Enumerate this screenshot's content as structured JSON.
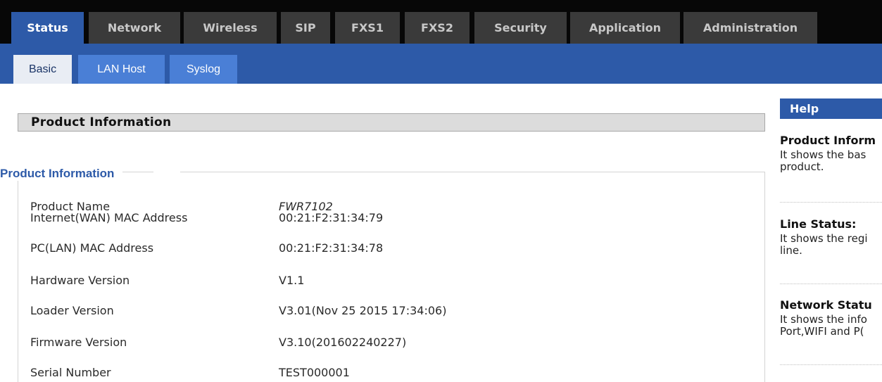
{
  "nav": {
    "tabs": [
      "Status",
      "Network",
      "Wireless",
      "SIP",
      "FXS1",
      "FXS2",
      "Security",
      "Application",
      "Administration"
    ],
    "active_tab": "Status"
  },
  "subnav": {
    "tabs": [
      "Basic",
      "LAN Host",
      "Syslog"
    ],
    "active_tab": "Basic"
  },
  "section": {
    "header": "Product Information",
    "legend": "Product Information",
    "rows": [
      {
        "label": "Product Name",
        "value": "FWR7102"
      },
      {
        "label": "Internet(WAN) MAC Address",
        "value": "00:21:F2:31:34:79"
      },
      {
        "label": "PC(LAN) MAC Address",
        "value": "00:21:F2:31:34:78"
      },
      {
        "label": "Hardware Version",
        "value": "V1.1"
      },
      {
        "label": "Loader Version",
        "value": "V3.01(Nov 25 2015 17:34:06)"
      },
      {
        "label": "Firmware Version",
        "value": "V3.10(201602240227)"
      },
      {
        "label": "Serial Number",
        "value": "TEST000001"
      }
    ]
  },
  "help": {
    "header": "Help",
    "items": [
      {
        "title": "Product Inform",
        "line1": "It shows the bas",
        "line2": "product."
      },
      {
        "title": "Line Status:",
        "line1": "It shows the regi",
        "line2": "line."
      },
      {
        "title": "Network Statu",
        "line1": "It shows the info",
        "line2": "Port,WIFI and P("
      }
    ]
  },
  "colors": {
    "nav_bg": "#070707",
    "tab_bg": "#3a3a3a",
    "accent": "#2d5aa8",
    "subtab_bg": "#4a7fd6"
  }
}
